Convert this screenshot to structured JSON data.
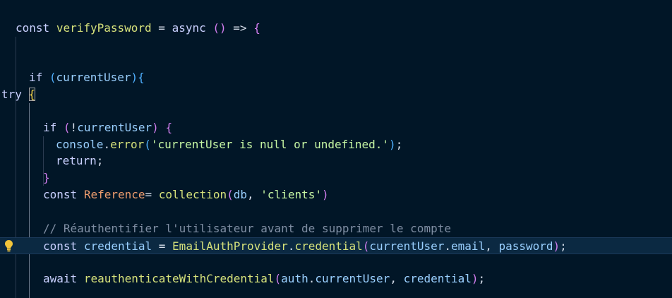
{
  "editor": {
    "lines": [
      {
        "tokens": [
          [
            "kw",
            "const"
          ],
          [
            "pl",
            " "
          ],
          [
            "fn",
            "verifyPassword"
          ],
          [
            "pl",
            " = "
          ],
          [
            "kw",
            "async"
          ],
          [
            "pl",
            " "
          ],
          [
            "p2",
            "()"
          ],
          [
            "pl",
            " => "
          ],
          [
            "p2",
            "{"
          ]
        ]
      },
      {
        "tokens": []
      },
      {
        "tokens": []
      },
      {
        "tokens": [
          [
            "kw",
            "if"
          ],
          [
            "pl",
            " "
          ],
          [
            "p3",
            "("
          ],
          [
            "var",
            "currentUser"
          ],
          [
            "p3",
            "){"
          ]
        ]
      },
      {
        "tokens": [
          [
            "kw",
            "try"
          ],
          [
            "pl",
            " "
          ],
          [
            "p1",
            "{"
          ]
        ]
      },
      {
        "tokens": []
      },
      {
        "tokens": [
          [
            "kw",
            "if"
          ],
          [
            "pl",
            " "
          ],
          [
            "p2",
            "("
          ],
          [
            "pl",
            "!"
          ],
          [
            "var",
            "currentUser"
          ],
          [
            "p2",
            ")"
          ],
          [
            "pl",
            " "
          ],
          [
            "p2",
            "{"
          ]
        ]
      },
      {
        "tokens": [
          [
            "var",
            "console"
          ],
          [
            "pl",
            "."
          ],
          [
            "fn",
            "error"
          ],
          [
            "p3",
            "("
          ],
          [
            "str",
            "'currentUser is null or undefined.'"
          ],
          [
            "p3",
            ")"
          ],
          [
            "pl",
            ";"
          ]
        ]
      },
      {
        "tokens": [
          [
            "kw",
            "return"
          ],
          [
            "pl",
            ";"
          ]
        ]
      },
      {
        "tokens": [
          [
            "p2",
            "}"
          ]
        ]
      },
      {
        "tokens": [
          [
            "kw",
            "const"
          ],
          [
            "pl",
            " "
          ],
          [
            "vr2",
            "Reference"
          ],
          [
            "pl",
            "= "
          ],
          [
            "fn",
            "collection"
          ],
          [
            "p2",
            "("
          ],
          [
            "var",
            "db"
          ],
          [
            "pl",
            ", "
          ],
          [
            "str",
            "'clients'"
          ],
          [
            "p2",
            ")"
          ]
        ]
      },
      {
        "tokens": []
      },
      {
        "tokens": [
          [
            "cm",
            "// Réauthentifier l'utilisateur avant de supprimer le compte"
          ]
        ]
      },
      {
        "tokens": [
          [
            "kw",
            "const"
          ],
          [
            "pl",
            " "
          ],
          [
            "var",
            "credential"
          ],
          [
            "pl",
            " = "
          ],
          [
            "fn",
            "EmailAuthProvider"
          ],
          [
            "pl",
            "."
          ],
          [
            "fn",
            "credential"
          ],
          [
            "p2",
            "("
          ],
          [
            "var",
            "currentUser"
          ],
          [
            "pl",
            "."
          ],
          [
            "var",
            "email"
          ],
          [
            "pl",
            ", "
          ],
          [
            "var",
            "password"
          ],
          [
            "p2",
            ")"
          ],
          [
            "pl",
            ";"
          ]
        ]
      },
      {
        "tokens": []
      },
      {
        "tokens": [
          [
            "kw",
            "await"
          ],
          [
            "pl",
            " "
          ],
          [
            "fn",
            "reauthenticateWithCredential"
          ],
          [
            "p2",
            "("
          ],
          [
            "var",
            "auth"
          ],
          [
            "pl",
            "."
          ],
          [
            "var",
            "currentUser"
          ],
          [
            "pl",
            ", "
          ],
          [
            "var",
            "credential"
          ],
          [
            "p2",
            ")"
          ],
          [
            "pl",
            ";"
          ]
        ]
      }
    ],
    "lightbulb_icon": "lightbulb-icon",
    "colors": {
      "background": "#011627",
      "active_line": "#0b2942"
    }
  }
}
